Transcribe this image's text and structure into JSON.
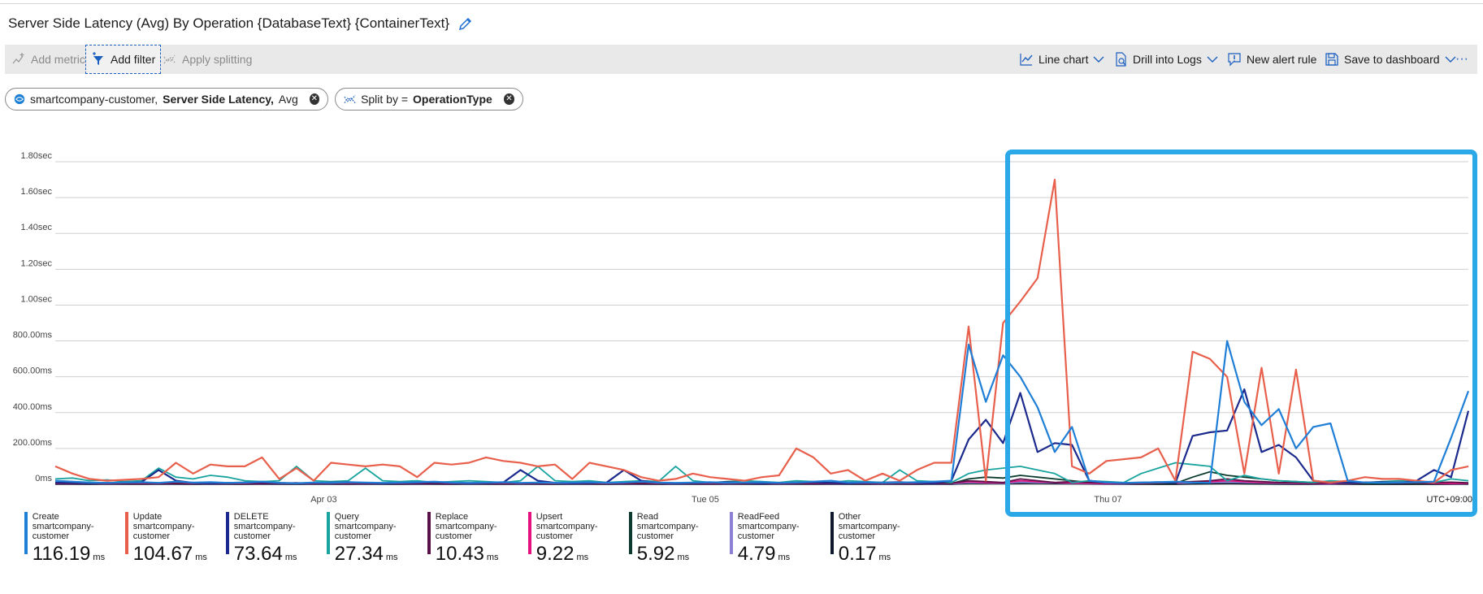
{
  "header": {
    "title": "Server Side Latency (Avg) By Operation {DatabaseText} {ContainerText}"
  },
  "toolbar": {
    "add_metric": "Add metric",
    "add_filter": "Add filter",
    "apply_splitting": "Apply splitting",
    "line_chart": "Line chart",
    "drill_logs": "Drill into Logs",
    "new_alert": "New alert rule",
    "save_dashboard": "Save to dashboard",
    "more": "···"
  },
  "pills": {
    "metric": {
      "resource": "smartcompany-customer,",
      "metric": "Server Side Latency,",
      "agg": "Avg"
    },
    "split": {
      "label": "Split by =",
      "value": "OperationType"
    }
  },
  "colors": {
    "Create": "#1f7fd6",
    "Update": "#e8604c",
    "DELETE": "#1b2a8c",
    "Query": "#18a39e",
    "Replace": "#5a1049",
    "Upsert": "#e3127e",
    "Read": "#0b3b2e",
    "ReadFeed": "#8b7fd6",
    "Other": "#0e1a2b",
    "highlight": "#2aa8e7"
  },
  "chart_data": {
    "type": "line",
    "title": "",
    "y_tick_labels": [
      "1.80sec",
      "1.60sec",
      "1.40sec",
      "1.20sec",
      "1.00sec",
      "800.00ms",
      "600.00ms",
      "400.00ms",
      "200.00ms",
      "0ms"
    ],
    "ylim_ms": [
      0,
      1800
    ],
    "x_tick_labels": [
      "Apr 03",
      "Tue 05",
      "Thu 07"
    ],
    "timezone": "UTC+09:00",
    "series": [
      {
        "name": "Create",
        "values": [
          20,
          15,
          10,
          8,
          10,
          12,
          8,
          15,
          10,
          12,
          8,
          10,
          15,
          8,
          6,
          10,
          8,
          12,
          10,
          8,
          10,
          12,
          15,
          10,
          8,
          10,
          12,
          8,
          10,
          8,
          10,
          12,
          8,
          10,
          15,
          10,
          8,
          10,
          12,
          8,
          10,
          12,
          8,
          10,
          15,
          20,
          10,
          12,
          8,
          10,
          12,
          15,
          20,
          780,
          460,
          720,
          600,
          430,
          180,
          320,
          20,
          10,
          8,
          10,
          12,
          15,
          10,
          8,
          800,
          460,
          330,
          420,
          200,
          320,
          340,
          20,
          10,
          8,
          10,
          12,
          15,
          260,
          520
        ]
      },
      {
        "name": "Update",
        "values": [
          100,
          60,
          30,
          20,
          25,
          30,
          40,
          120,
          60,
          110,
          100,
          100,
          150,
          30,
          90,
          20,
          120,
          110,
          100,
          110,
          100,
          40,
          120,
          110,
          120,
          150,
          130,
          120,
          100,
          110,
          30,
          120,
          100,
          80,
          40,
          20,
          30,
          60,
          40,
          30,
          20,
          40,
          50,
          200,
          150,
          60,
          80,
          20,
          60,
          20,
          80,
          120,
          120,
          880,
          20,
          900,
          1020,
          1150,
          1700,
          100,
          60,
          130,
          140,
          150,
          200,
          20,
          740,
          700,
          600,
          60,
          650,
          60,
          640,
          20,
          10,
          20,
          40,
          30,
          30,
          20,
          10,
          80,
          100
        ]
      },
      {
        "name": "DELETE",
        "values": [
          10,
          8,
          6,
          8,
          10,
          12,
          80,
          20,
          8,
          6,
          8,
          10,
          12,
          8,
          6,
          8,
          10,
          12,
          8,
          6,
          8,
          10,
          12,
          8,
          6,
          8,
          10,
          80,
          20,
          8,
          6,
          8,
          10,
          80,
          20,
          8,
          6,
          8,
          10,
          12,
          8,
          6,
          8,
          10,
          12,
          8,
          6,
          8,
          10,
          12,
          8,
          6,
          20,
          250,
          360,
          230,
          510,
          180,
          230,
          220,
          20,
          10,
          8,
          10,
          12,
          8,
          270,
          290,
          300,
          530,
          180,
          220,
          150,
          20,
          10,
          8,
          10,
          12,
          8,
          20,
          80,
          40,
          410
        ]
      },
      {
        "name": "Query",
        "values": [
          30,
          35,
          20,
          25,
          15,
          20,
          90,
          40,
          30,
          50,
          40,
          20,
          15,
          20,
          100,
          20,
          15,
          20,
          90,
          20,
          15,
          20,
          10,
          15,
          20,
          15,
          10,
          20,
          100,
          20,
          15,
          20,
          10,
          15,
          20,
          15,
          100,
          20,
          10,
          15,
          20,
          15,
          10,
          20,
          15,
          10,
          20,
          15,
          10,
          80,
          20,
          15,
          10,
          60,
          80,
          90,
          100,
          80,
          60,
          10,
          20,
          15,
          10,
          60,
          90,
          120,
          110,
          100,
          20,
          50,
          30,
          20,
          15,
          10,
          20,
          15,
          10,
          15,
          20,
          15,
          10,
          30,
          20
        ]
      },
      {
        "name": "Replace",
        "values": [
          5,
          6,
          8,
          5,
          6,
          8,
          5,
          6,
          8,
          5,
          6,
          8,
          5,
          6,
          8,
          5,
          6,
          8,
          5,
          6,
          8,
          5,
          6,
          8,
          5,
          6,
          8,
          5,
          6,
          8,
          5,
          6,
          8,
          5,
          6,
          8,
          5,
          6,
          8,
          5,
          6,
          8,
          5,
          6,
          8,
          5,
          6,
          8,
          5,
          6,
          8,
          5,
          6,
          20,
          15,
          10,
          30,
          20,
          10,
          15,
          10,
          8,
          6,
          8,
          10,
          12,
          15,
          20,
          30,
          20,
          15,
          10,
          8,
          6,
          8,
          10,
          12,
          8,
          6,
          8,
          10,
          12,
          8
        ]
      },
      {
        "name": "Upsert",
        "values": [
          4,
          5,
          6,
          4,
          5,
          6,
          4,
          5,
          6,
          4,
          5,
          6,
          4,
          5,
          6,
          4,
          5,
          6,
          4,
          5,
          6,
          4,
          5,
          6,
          4,
          5,
          6,
          4,
          5,
          6,
          4,
          5,
          6,
          4,
          5,
          6,
          4,
          5,
          6,
          4,
          5,
          6,
          4,
          5,
          6,
          4,
          5,
          6,
          4,
          5,
          6,
          4,
          5,
          15,
          10,
          8,
          20,
          15,
          10,
          8,
          6,
          4,
          5,
          6,
          8,
          10,
          12,
          15,
          20,
          15,
          10,
          8,
          6,
          4,
          5,
          6,
          8,
          10,
          12,
          8,
          6,
          4,
          5
        ]
      },
      {
        "name": "Read",
        "values": [
          3,
          4,
          5,
          3,
          4,
          5,
          3,
          4,
          5,
          3,
          4,
          5,
          3,
          4,
          5,
          3,
          4,
          5,
          3,
          4,
          5,
          3,
          4,
          5,
          3,
          4,
          5,
          3,
          4,
          5,
          3,
          4,
          5,
          3,
          4,
          5,
          3,
          4,
          5,
          3,
          4,
          5,
          3,
          4,
          5,
          3,
          4,
          5,
          3,
          4,
          5,
          3,
          4,
          30,
          40,
          35,
          50,
          40,
          30,
          20,
          10,
          5,
          4,
          3,
          4,
          5,
          40,
          70,
          50,
          40,
          30,
          20,
          15,
          10,
          5,
          4,
          3,
          4,
          5,
          3,
          4,
          5,
          3
        ]
      },
      {
        "name": "ReadFeed",
        "values": [
          2,
          3,
          4,
          2,
          3,
          4,
          2,
          3,
          4,
          2,
          3,
          4,
          2,
          3,
          4,
          2,
          3,
          4,
          2,
          3,
          4,
          2,
          3,
          4,
          2,
          3,
          4,
          2,
          3,
          4,
          2,
          3,
          4,
          2,
          3,
          4,
          2,
          3,
          4,
          2,
          3,
          4,
          2,
          3,
          4,
          2,
          3,
          4,
          2,
          3,
          4,
          2,
          3,
          10,
          8,
          6,
          12,
          10,
          8,
          6,
          4,
          3,
          2,
          3,
          4,
          6,
          8,
          10,
          12,
          10,
          8,
          6,
          4,
          3,
          2,
          3,
          4,
          6,
          8,
          6,
          4,
          3,
          2
        ]
      },
      {
        "name": "Other",
        "values": [
          0,
          0,
          0,
          0,
          0,
          0,
          0,
          0,
          0,
          0,
          0,
          0,
          0,
          0,
          0,
          0,
          0,
          0,
          0,
          0,
          0,
          0,
          0,
          0,
          0,
          0,
          0,
          0,
          0,
          0,
          0,
          0,
          0,
          0,
          0,
          0,
          0,
          0,
          0,
          0,
          0,
          0,
          0,
          0,
          0,
          0,
          0,
          0,
          0,
          0,
          0,
          0,
          0,
          5,
          6,
          4,
          5,
          6,
          4,
          3,
          2,
          1,
          0,
          0,
          0,
          0,
          2,
          3,
          4,
          3,
          2,
          1,
          0,
          0,
          0,
          0,
          0,
          0,
          0,
          0,
          0,
          0,
          0
        ]
      }
    ]
  },
  "legend": [
    {
      "name": "Create",
      "sub": "smartcompany-customer",
      "value": "116.19",
      "unit": "ms"
    },
    {
      "name": "Update",
      "sub": "smartcompany-customer",
      "value": "104.67",
      "unit": "ms"
    },
    {
      "name": "DELETE",
      "sub": "smartcompany-customer",
      "value": "73.64",
      "unit": "ms"
    },
    {
      "name": "Query",
      "sub": "smartcompany-customer",
      "value": "27.34",
      "unit": "ms"
    },
    {
      "name": "Replace",
      "sub": "smartcompany-customer",
      "value": "10.43",
      "unit": "ms"
    },
    {
      "name": "Upsert",
      "sub": "smartcompany-customer",
      "value": "9.22",
      "unit": "ms"
    },
    {
      "name": "Read",
      "sub": "smartcompany-customer",
      "value": "5.92",
      "unit": "ms"
    },
    {
      "name": "ReadFeed",
      "sub": "smartcompany-customer",
      "value": "4.79",
      "unit": "ms"
    },
    {
      "name": "Other",
      "sub": "smartcompany-customer",
      "value": "0.17",
      "unit": "ms"
    }
  ]
}
